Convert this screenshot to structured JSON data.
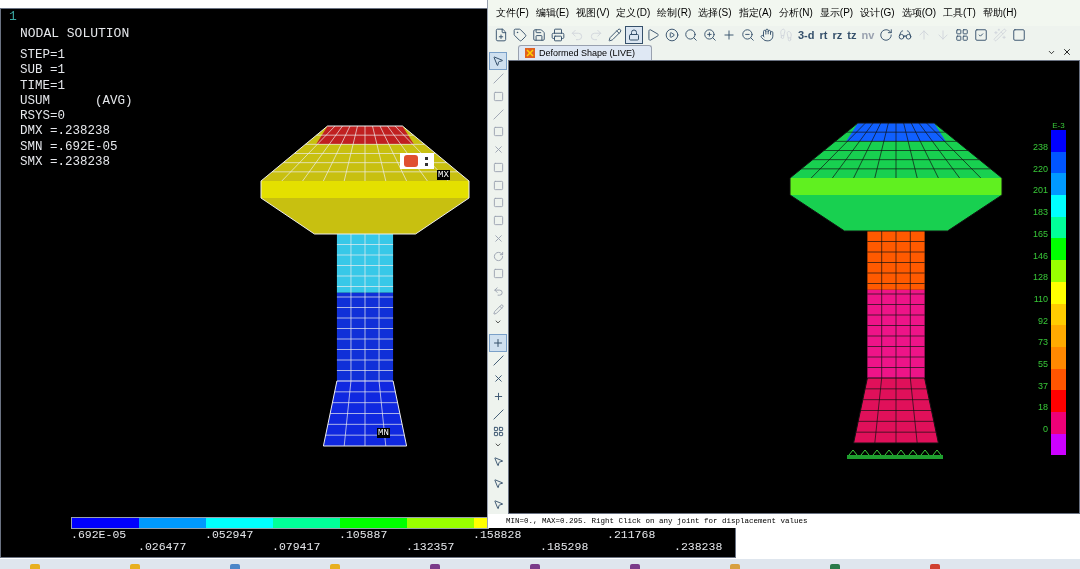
{
  "left_window": {
    "frame_number": "1",
    "title": "NODAL SOLUTION",
    "info_lines": [
      "STEP=1",
      "SUB =1",
      "TIME=1",
      "USUM      (AVG)",
      "RSYS=0",
      "DMX =.238238",
      "SMN =.692E-05",
      "SMX =.238238"
    ],
    "max_marker": "MX",
    "min_marker": "MN",
    "legend": {
      "segments": [
        {
          "color": "#0000ff"
        },
        {
          "color": "#0099ff"
        },
        {
          "color": "#00ffff"
        },
        {
          "color": "#00ff99"
        },
        {
          "color": "#00ff00"
        },
        {
          "color": "#99ff00"
        },
        {
          "color": "#ffff00"
        }
      ],
      "labels": [
        ".692E-05",
        ".026477",
        ".052947",
        ".079417",
        ".105887",
        ".132357",
        ".158828",
        ".185298",
        ".211768",
        ".238238"
      ]
    }
  },
  "right_window": {
    "menu": [
      "文件(F)",
      "编辑(E)",
      "视图(V)",
      "定义(D)",
      "绘制(R)",
      "选择(S)",
      "指定(A)",
      "分析(N)",
      "显示(P)",
      "设计(G)",
      "选项(O)",
      "工具(T)",
      "帮助(H)"
    ],
    "toolbar_text_buttons": [
      {
        "label": "3-d",
        "disabled": false
      },
      {
        "label": "rt",
        "disabled": false
      },
      {
        "label": "rz",
        "disabled": false
      },
      {
        "label": "tz",
        "disabled": false
      },
      {
        "label": "nv",
        "disabled": true
      }
    ],
    "tab": {
      "label": "Deformed Shape (LIVE)",
      "selected": true
    },
    "legend": {
      "unit": "E-3",
      "labels": [
        "238",
        "220",
        "201",
        "183",
        "165",
        "146",
        "128",
        "110",
        "92",
        "73",
        "55",
        "37",
        "18",
        "0"
      ],
      "segments": [
        {
          "color": "#0000ff"
        },
        {
          "color": "#0055ff"
        },
        {
          "color": "#0099ff"
        },
        {
          "color": "#00ffff"
        },
        {
          "color": "#00ff99"
        },
        {
          "color": "#00ff00"
        },
        {
          "color": "#99ff00"
        },
        {
          "color": "#ffff00"
        },
        {
          "color": "#ffcc00"
        },
        {
          "color": "#ffaa00"
        },
        {
          "color": "#ff8800"
        },
        {
          "color": "#ff5500"
        },
        {
          "color": "#ff0000"
        },
        {
          "color": "#ee0077"
        },
        {
          "color": "#cc00ff"
        }
      ]
    },
    "status": "MIN=0., MAX=0.295. Right Click on any joint for displacement values"
  }
}
